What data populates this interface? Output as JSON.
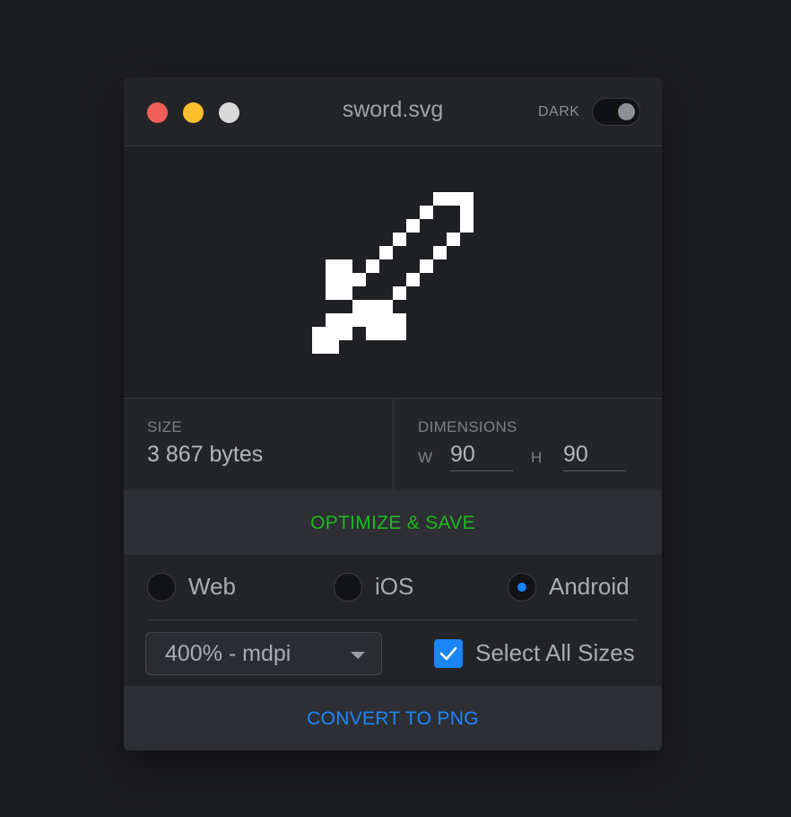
{
  "window": {
    "title": "sword.svg",
    "dark_toggle": {
      "label": "DARK",
      "on": true
    }
  },
  "info": {
    "size_label": "SIZE",
    "size_value": "3 867 bytes",
    "dimensions_label": "DIMENSIONS",
    "width_label": "W",
    "width_value": "90",
    "height_label": "H",
    "height_value": "90"
  },
  "actions": {
    "optimize_label": "OPTIMIZE & SAVE",
    "convert_label": "CONVERT TO PNG"
  },
  "platforms": {
    "options": [
      "Web",
      "iOS",
      "Android"
    ],
    "selected": "Android"
  },
  "export": {
    "density_selected": "400% - mdpi",
    "select_all_label": "Select All Sizes",
    "select_all_checked": true
  },
  "colors": {
    "optimize": "#1fb81f",
    "convert": "#1a87ff",
    "radio_selected": "#1486ff",
    "checkbox": "#1a85f5"
  },
  "icons": {
    "preview": "sword-icon",
    "close": "close-dot",
    "minimize": "minimize-dot",
    "zoom": "zoom-dot"
  }
}
